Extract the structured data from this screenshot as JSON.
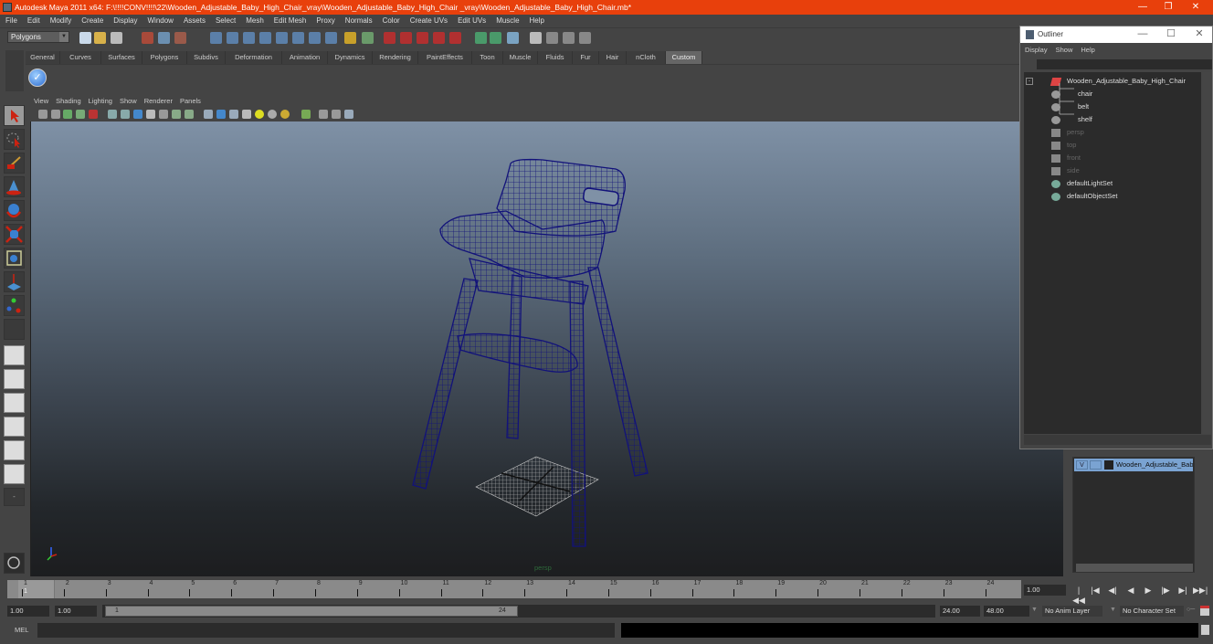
{
  "window": {
    "title": "Autodesk Maya 2011 x64: F:\\!!!!CONV!!!!\\22\\Wooden_Adjustable_Baby_High_Chair_vray\\Wooden_Adjustable_Baby_High_Chair _vray\\Wooden_Adjustable_Baby_High_Chair.mb*",
    "minimize": "—",
    "maximize": "❐",
    "close": "✕"
  },
  "menubar": [
    "File",
    "Edit",
    "Modify",
    "Create",
    "Display",
    "Window",
    "Assets",
    "Select",
    "Mesh",
    "Edit Mesh",
    "Proxy",
    "Normals",
    "Color",
    "Create UVs",
    "Edit UVs",
    "Muscle",
    "Help"
  ],
  "statusline": {
    "mode": "Polygons"
  },
  "shelf": {
    "tabs": [
      "General",
      "Curves",
      "Surfaces",
      "Polygons",
      "Subdivs",
      "Deformation",
      "Animation",
      "Dynamics",
      "Rendering",
      "PaintEffects",
      "Toon",
      "Muscle",
      "Fluids",
      "Fur",
      "Hair",
      "nCloth",
      "Custom"
    ],
    "active_tab": "Custom"
  },
  "panel": {
    "menu": [
      "View",
      "Shading",
      "Lighting",
      "Show",
      "Renderer",
      "Panels"
    ],
    "camera_label": "persp"
  },
  "outliner": {
    "title": "Outliner",
    "menu": [
      "Display",
      "Show",
      "Help"
    ],
    "items": [
      {
        "label": "Wooden_Adjustable_Baby_High_Chair",
        "type": "group",
        "dim": false
      },
      {
        "label": "chair",
        "type": "mesh",
        "dim": false
      },
      {
        "label": "belt",
        "type": "mesh",
        "dim": false
      },
      {
        "label": "shelf",
        "type": "mesh",
        "dim": false
      },
      {
        "label": "persp",
        "type": "camera",
        "dim": true
      },
      {
        "label": "top",
        "type": "camera",
        "dim": true
      },
      {
        "label": "front",
        "type": "camera",
        "dim": true
      },
      {
        "label": "side",
        "type": "camera",
        "dim": true
      },
      {
        "label": "defaultLightSet",
        "type": "set",
        "dim": false
      },
      {
        "label": "defaultObjectSet",
        "type": "set",
        "dim": false
      }
    ]
  },
  "layer_editor": {
    "layers": [
      {
        "visible": "V",
        "label": "Wooden_Adjustable_Bab"
      }
    ]
  },
  "timeline": {
    "ticks": [
      "1",
      "2",
      "3",
      "4",
      "5",
      "6",
      "7",
      "8",
      "9",
      "10",
      "11",
      "12",
      "13",
      "14",
      "15",
      "16",
      "17",
      "18",
      "19",
      "20",
      "21",
      "22",
      "23",
      "24"
    ],
    "current_frame": "1",
    "current_time_field": "1.00"
  },
  "range": {
    "start_time": "1.00",
    "playback_start": "1.00",
    "range_start_label": "1",
    "range_end_label": "24",
    "playback_end": "24.00",
    "end_time": "48.00",
    "anim_layer": "No Anim Layer",
    "character_set": "No Character Set"
  },
  "playback": [
    "|◀◀",
    "|◀",
    "◀|",
    "◀",
    "▶",
    "|▶",
    "▶|",
    "▶▶|"
  ],
  "cmdline": {
    "label": "MEL"
  },
  "colors": {
    "titlebar": "#e8400c",
    "wireframe": "#12127a",
    "ui_bg": "#444444",
    "layer_highlight": "#7aa3d2"
  }
}
